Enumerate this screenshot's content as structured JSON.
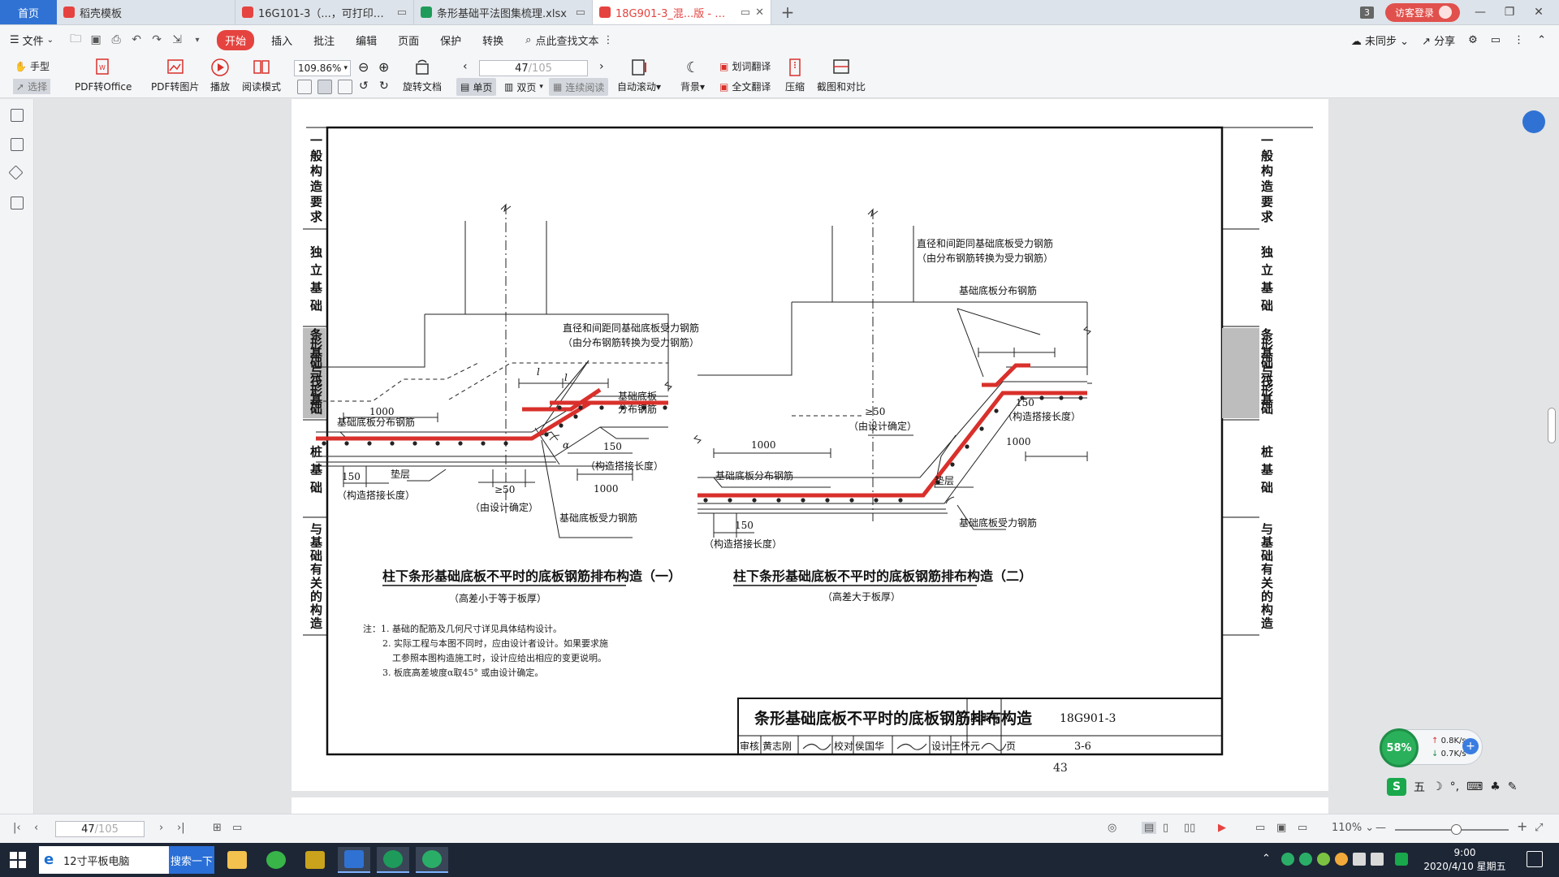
{
  "tabs": {
    "home": "首页",
    "items": [
      {
        "title": "稻壳模板",
        "color": "#e5433f",
        "active": false
      },
      {
        "title": "16G101-3（...，可打印）.pdf",
        "color": "#e5433f",
        "active": false
      },
      {
        "title": "条形基础平法图集梳理.xlsx",
        "color": "#1e9b5a",
        "active": false
      },
      {
        "title": "18G901-3_混...版 - 副本.pdf",
        "color": "#e5433f",
        "active": true
      }
    ],
    "add": "+",
    "window_count": "3",
    "login": "访客登录"
  },
  "menu": {
    "file": "文件",
    "items": [
      "开始",
      "插入",
      "批注",
      "编辑",
      "页面",
      "保护",
      "转换"
    ],
    "search": "点此查找文本",
    "right": {
      "sync": "未同步",
      "share": "分享"
    }
  },
  "toolbar": {
    "hand": "手型",
    "select": "选择",
    "pdf_to_office": "PDF转Office",
    "pdf_to_image": "PDF转图片",
    "play": "播放",
    "reading_mode": "阅读模式",
    "zoom": "109.86%",
    "rotate": "旋转文档",
    "page_current": "47",
    "page_total": "/105",
    "single": "单页",
    "double": "双页",
    "continuous": "连续阅读",
    "auto_scroll": "自动滚动",
    "background": "背景",
    "word_translate": "划词翻译",
    "full_translate": "全文翻译",
    "compress": "压缩",
    "screenshot_compare": "截图和对比"
  },
  "doc": {
    "side_tabs": [
      {
        "text": "一般构造要求",
        "hl": false
      },
      {
        "text": "独立基础",
        "hl": false
      },
      {
        "text": "条形基础与筏形基础",
        "hl": true
      },
      {
        "text": "桩基础",
        "hl": false
      },
      {
        "text": "与基础有关的构造",
        "hl": false
      }
    ],
    "fig1": {
      "title": "柱下条形基础底板不平时的底板钢筋排布构造（一）",
      "subtitle": "（高差小于等于板厚）",
      "labels": {
        "dist_bar": "基础底板分布钢筋",
        "dim_1000": "1000",
        "dim_150": "150",
        "lap": "（构造搭接长度）",
        "cushion": "垫层",
        "ge50": "≥50",
        "by_design": "（由设计确定）",
        "main_bar": "基础底板受力钢筋",
        "top_note1": "直径和间距同基础底板受力钢筋",
        "top_note2": "（由分布钢筋转换为受力钢筋）",
        "dist_bar2a": "基础底板",
        "dist_bar2b": "分布钢筋",
        "la": "l",
        "alpha": "α"
      }
    },
    "fig2": {
      "title": "柱下条形基础底板不平时的底板钢筋排布构造（二）",
      "subtitle": "（高差大于板厚）",
      "labels": {
        "top_note1": "直径和间距同基础底板受力钢筋",
        "top_note2": "（由分布钢筋转换为受力钢筋）",
        "dist_bar": "基础底板分布钢筋",
        "dist_bar_low": "基础底板分布钢筋",
        "dim_1000": "1000",
        "dim_150": "150",
        "lap": "（构造搭接长度）",
        "ge50": "≥50",
        "by_design": "（由设计确定）",
        "cushion": "垫层",
        "main_bar": "基础底板受力钢筋"
      }
    },
    "notes": [
      "注：1. 基础的配筋及几何尺寸详见具体结构设计。",
      "2. 实际工程与本图不同时，应由设计者设计。如果要求施",
      "工参照本图构造施工时，设计应给出相应的变更说明。",
      "3. 板底高差坡度α取45° 或由设计确定。"
    ],
    "titleblock": {
      "title": "条形基础底板不平时的底板钢筋排布构造",
      "atlas_label": "图集号",
      "atlas_no": "18G901-3",
      "review": "审核",
      "reviewer": "黄志刚",
      "check": "校对",
      "checker": "侯国华",
      "design": "设计",
      "designer": "王怀元",
      "page_label": "页",
      "page_no": "3-6"
    },
    "page_number": "43"
  },
  "status": {
    "page_current": "47",
    "page_total": "/105",
    "zoom": "110%"
  },
  "net": {
    "percent": "58%",
    "up": "0.8K/s",
    "down": "0.7K/s"
  },
  "ime": {
    "mode": "五"
  },
  "taskbar": {
    "search_text": "12寸平板电脑",
    "search_btn": "搜索一下",
    "time": "9:00",
    "date": "2020/4/10 星期五"
  },
  "colors": {
    "accent": "#2f72d4",
    "brand_red": "#e5433f",
    "rebar_red": "#d9302b"
  }
}
